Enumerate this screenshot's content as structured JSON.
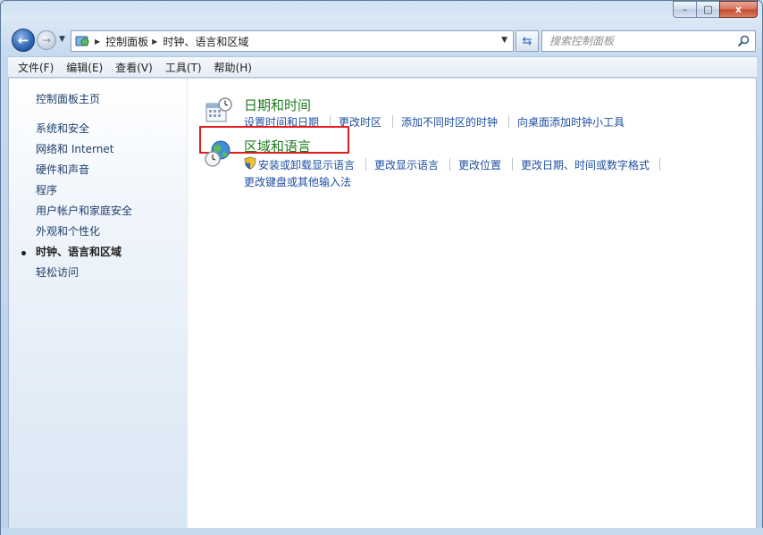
{
  "window": {
    "caption_buttons": {
      "minimize": "–",
      "maximize": "□",
      "close": "x"
    }
  },
  "nav": {
    "back_icon": "back-arrow-icon",
    "forward_icon": "forward-arrow-icon",
    "history_dropdown_icon": "chevron-down-icon",
    "address": {
      "crumbs": [
        "控制面板",
        "时钟、语言和区域"
      ],
      "dropdown_icon": "chevron-down-icon"
    },
    "refresh_icon": "refresh-icon",
    "search": {
      "placeholder": "搜索控制面板",
      "value": ""
    }
  },
  "menu": {
    "items": [
      "文件(F)",
      "编辑(E)",
      "查看(V)",
      "工具(T)",
      "帮助(H)"
    ]
  },
  "sidebar": {
    "items": [
      {
        "label": "控制面板主页",
        "active": false
      },
      {
        "label": "系统和安全",
        "active": false
      },
      {
        "label": "网络和 Internet",
        "active": false
      },
      {
        "label": "硬件和声音",
        "active": false
      },
      {
        "label": "程序",
        "active": false
      },
      {
        "label": "用户帐户和家庭安全",
        "active": false
      },
      {
        "label": "外观和个性化",
        "active": false
      },
      {
        "label": "时钟、语言和区域",
        "active": true
      },
      {
        "label": "轻松访问",
        "active": false
      }
    ]
  },
  "categories": [
    {
      "title": "日期和时间",
      "icon": "calendar-clock-icon",
      "tasks": [
        "设置时间和日期",
        "更改时区",
        "添加不同时区的时钟",
        "向桌面添加时钟小工具"
      ]
    },
    {
      "title": "区域和语言",
      "icon": "globe-clock-icon",
      "tasks": [
        "安装或卸载显示语言",
        "更改显示语言",
        "更改位置",
        "更改日期、时间或数字格式",
        "更改键盘或其他输入法"
      ]
    }
  ],
  "colors": {
    "category_title": "#1f7a1f",
    "task_link": "#1f4fa1",
    "highlight_box": "#e01c1c"
  }
}
